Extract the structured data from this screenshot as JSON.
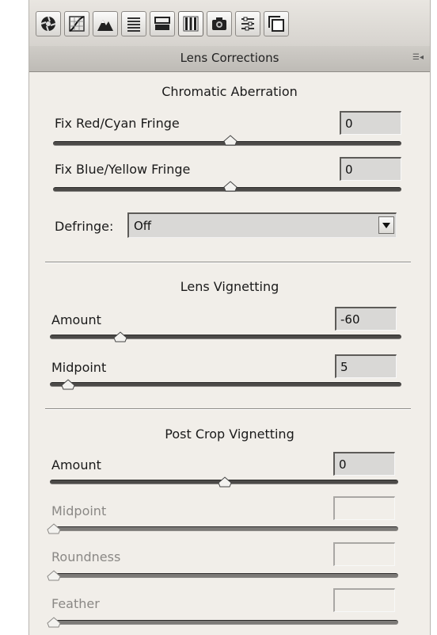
{
  "panel": {
    "title": "Lens Corrections",
    "menu_icon": "panel-menu-icon"
  },
  "toolbar": {
    "tools": [
      {
        "name": "basic-icon"
      },
      {
        "name": "tone-curve-icon"
      },
      {
        "name": "detail-icon"
      },
      {
        "name": "hsl-grayscale-icon"
      },
      {
        "name": "split-toning-icon"
      },
      {
        "name": "lens-corrections-icon",
        "active": true
      },
      {
        "name": "camera-calibration-icon"
      },
      {
        "name": "presets-icon"
      },
      {
        "name": "snapshots-icon"
      }
    ]
  },
  "chromatic": {
    "title": "Chromatic Aberration",
    "red_cyan": {
      "label": "Fix Red/Cyan Fringe",
      "value": "0",
      "min": -100,
      "max": 100
    },
    "blue_yellow": {
      "label": "Fix Blue/Yellow Fringe",
      "value": "0",
      "min": -100,
      "max": 100
    },
    "defringe": {
      "label": "Defringe:",
      "selected": "Off"
    }
  },
  "vignetting": {
    "title": "Lens Vignetting",
    "amount": {
      "label": "Amount",
      "value": "-60",
      "min": -100,
      "max": 100
    },
    "midpoint": {
      "label": "Midpoint",
      "value": "5",
      "min": 0,
      "max": 100
    }
  },
  "post_crop": {
    "title": "Post Crop Vignetting",
    "amount": {
      "label": "Amount",
      "value": "0",
      "min": -100,
      "max": 100
    },
    "midpoint": {
      "label": "Midpoint",
      "value": ""
    },
    "roundness": {
      "label": "Roundness",
      "value": ""
    },
    "feather": {
      "label": "Feather",
      "value": ""
    }
  },
  "colors": {
    "panel_bg": "#f1eee9",
    "track": "#4c4a48",
    "disabled_text": "#8a8885"
  }
}
